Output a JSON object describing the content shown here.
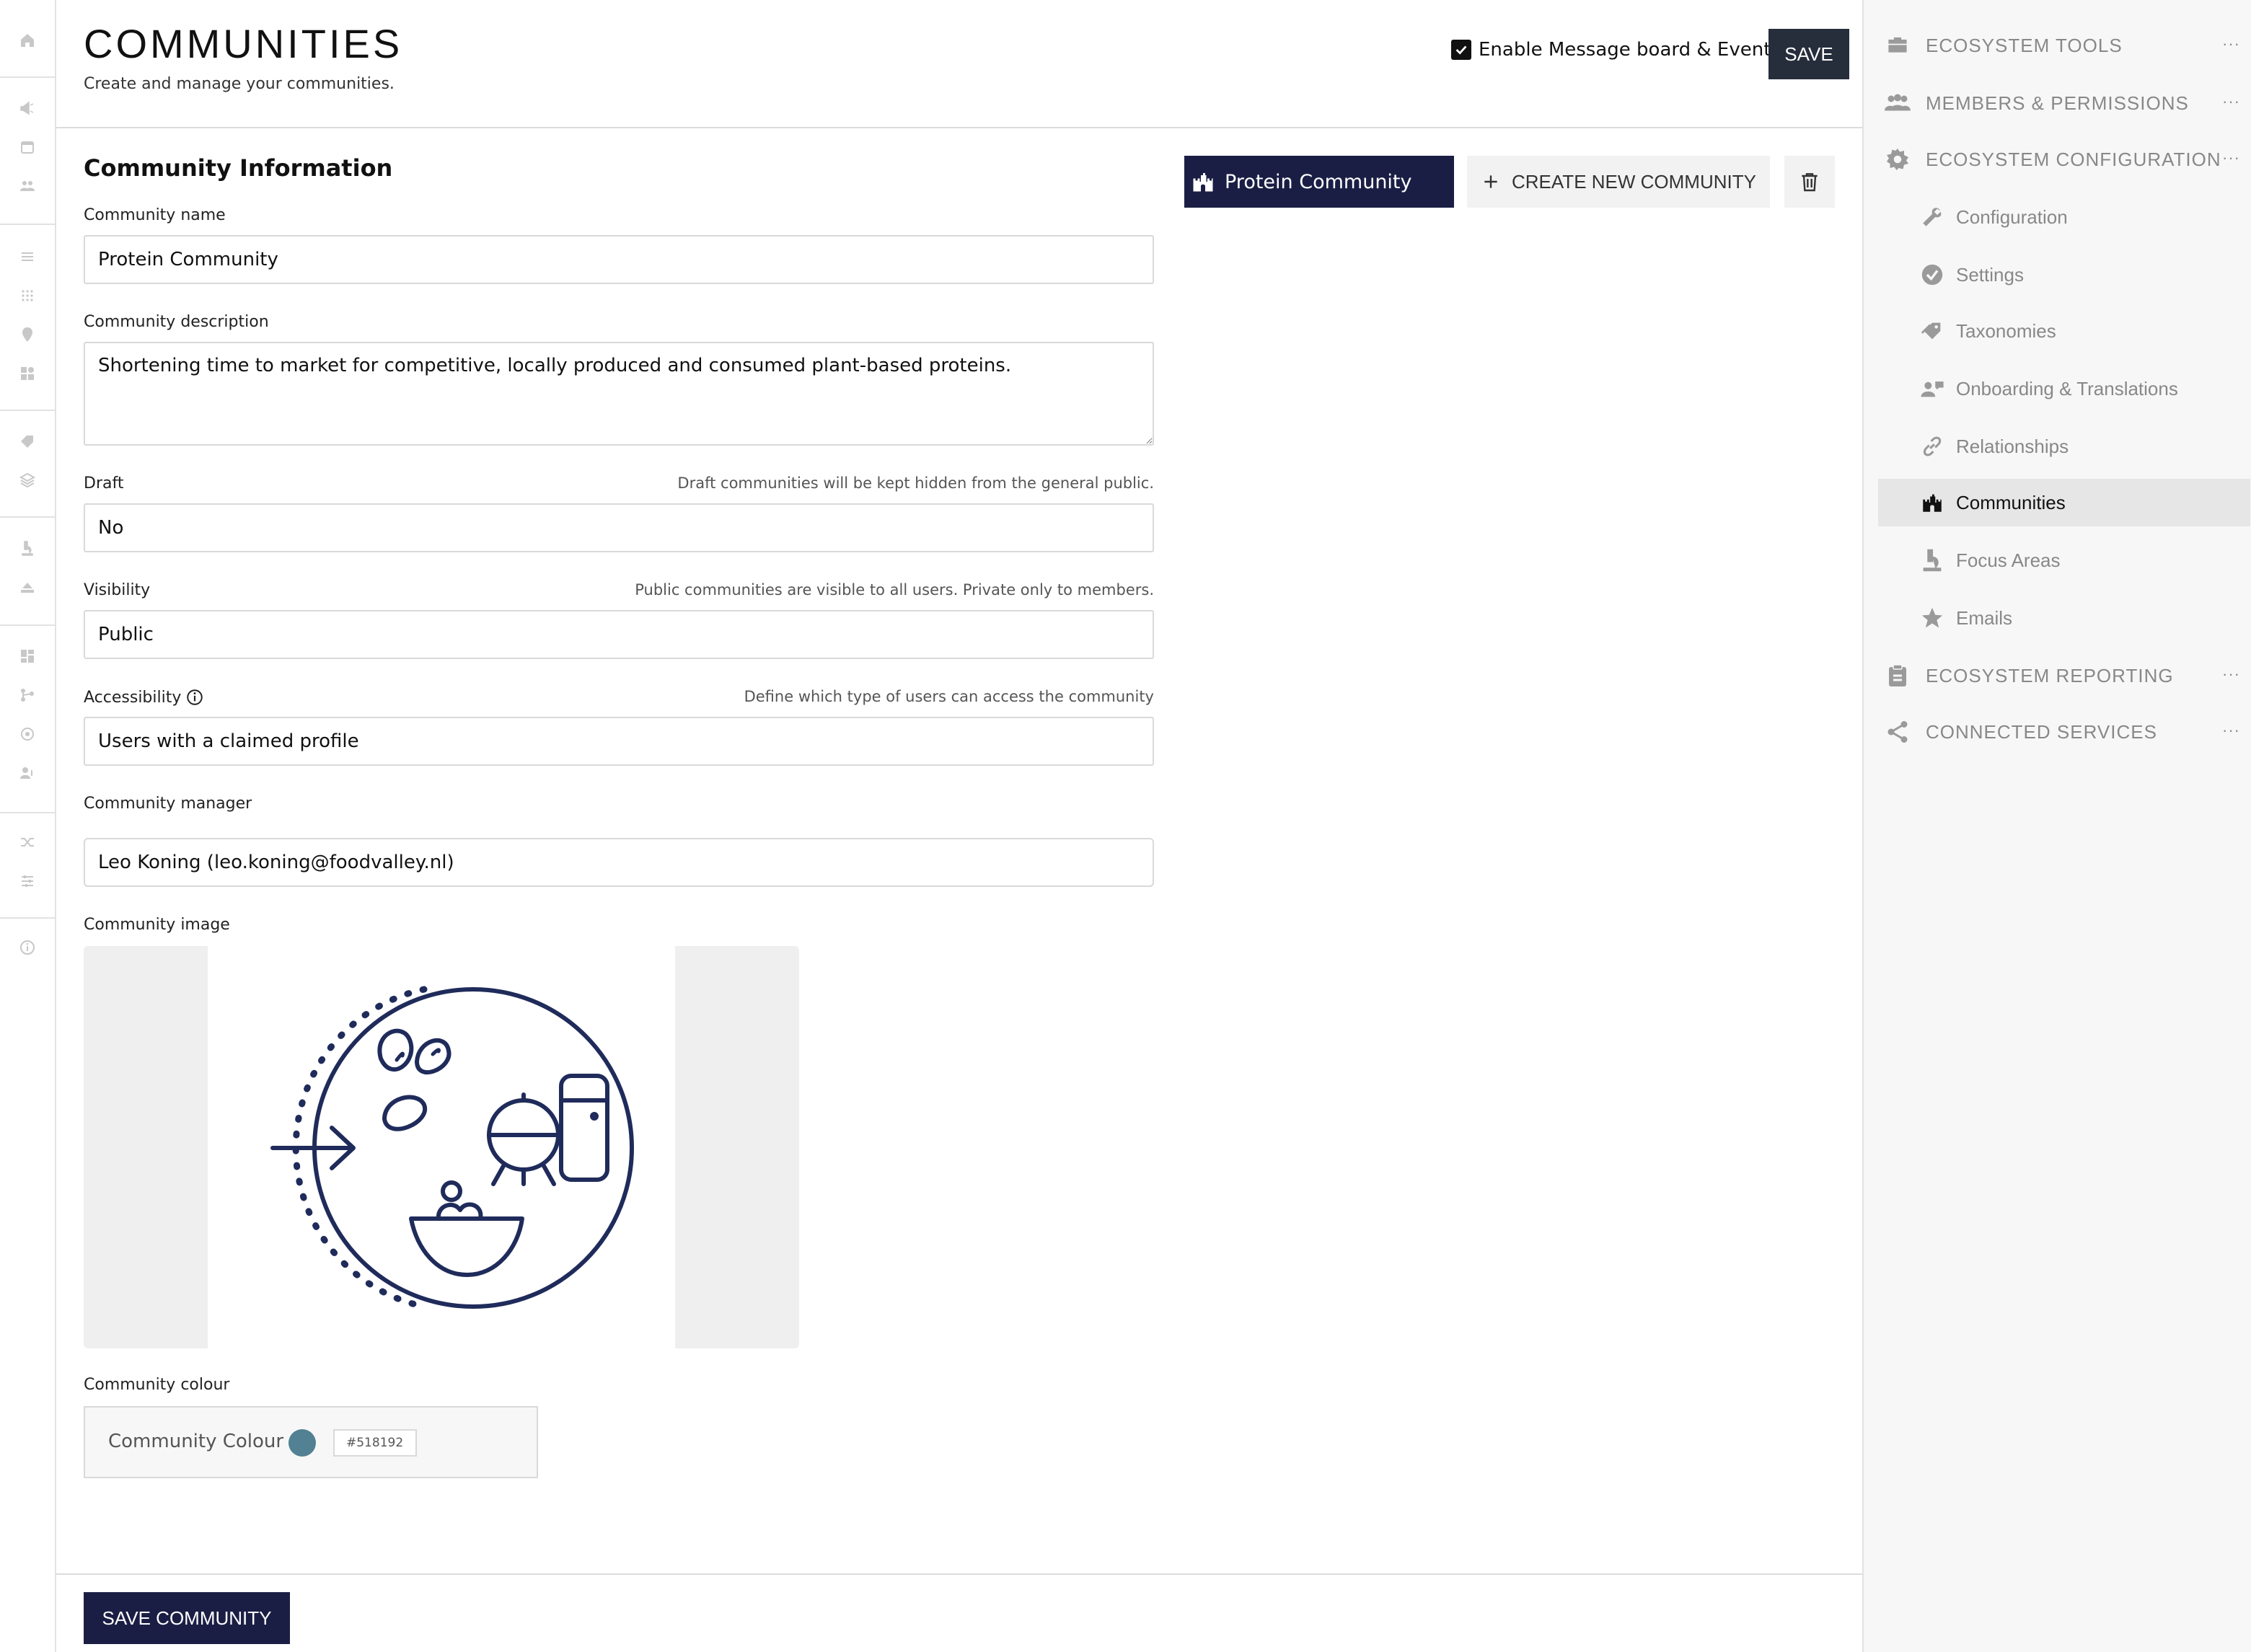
{
  "header": {
    "title": "COMMUNITIES",
    "subtitle": "Create and manage your communities.",
    "enable_label": "Enable Message board & Events",
    "save_label": "SAVE"
  },
  "tabs": {
    "active_label": "Protein Community",
    "create_label": "CREATE NEW COMMUNITY"
  },
  "form": {
    "section_title": "Community Information",
    "name_label": "Community name",
    "name_value": "Protein Community",
    "description_label": "Community description",
    "description_value": "Shortening time to market for competitive, locally produced and consumed plant-based proteins.",
    "draft_label": "Draft",
    "draft_hint": "Draft communities will be kept hidden from the general public.",
    "draft_value": "No",
    "visibility_label": "Visibility",
    "visibility_hint": "Public communities are visible to all users. Private only to members.",
    "visibility_value": "Public",
    "accessibility_label": "Accessibility",
    "accessibility_hint": "Define which type of users can access the community",
    "accessibility_value": "Users with a claimed profile",
    "manager_label": "Community manager",
    "manager_value": "Leo Koning (leo.koning@foodvalley.nl)",
    "image_label": "Community image",
    "colour_label": "Community colour",
    "colour_inner_label": "Community Colour",
    "colour_hex": "#518192",
    "save_community_label": "SAVE COMMUNITY"
  },
  "colors": {
    "navy": "#1b1e44",
    "dark_button": "#262d3b",
    "community_colour": "#518192",
    "illustration": "#1f2b5a"
  },
  "right_nav": {
    "top_items": [
      {
        "label": "ECOSYSTEM TOOLS",
        "icon": "toolbox-icon"
      },
      {
        "label": "MEMBERS & PERMISSIONS",
        "icon": "members-icon"
      },
      {
        "label": "ECOSYSTEM CONFIGURATION",
        "icon": "gear-icon"
      }
    ],
    "sub_items": [
      {
        "label": "Configuration",
        "icon": "wrench-icon"
      },
      {
        "label": "Settings",
        "icon": "check-circle-icon"
      },
      {
        "label": "Taxonomies",
        "icon": "tags-icon"
      },
      {
        "label": "Onboarding & Translations",
        "icon": "onboarding-icon"
      },
      {
        "label": "Relationships",
        "icon": "link-icon"
      },
      {
        "label": "Communities",
        "icon": "castle-icon"
      },
      {
        "label": "Focus Areas",
        "icon": "microscope-icon"
      },
      {
        "label": "Emails",
        "icon": "star-icon"
      }
    ],
    "bottom_items": [
      {
        "label": "ECOSYSTEM REPORTING",
        "icon": "clipboard-icon"
      },
      {
        "label": "CONNECTED SERVICES",
        "icon": "share-icon"
      }
    ],
    "more_glyph": "···"
  }
}
